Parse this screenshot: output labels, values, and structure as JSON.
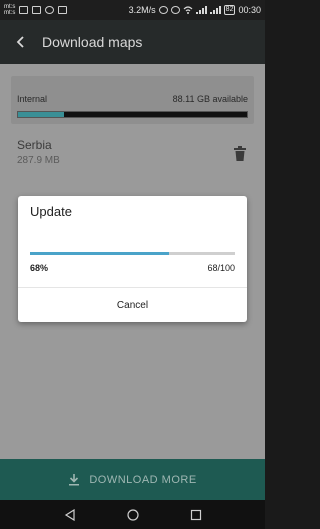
{
  "status_bar": {
    "carrier_line1": "mt:s",
    "carrier_line2": "mt:s",
    "speed": "3.2M/s",
    "battery": "82",
    "time": "00:30"
  },
  "appbar": {
    "title": "Download maps"
  },
  "storage": {
    "label": "Internal",
    "available": "88.11 GB available",
    "used_fraction": 0.2
  },
  "map_item": {
    "name": "Serbia",
    "size": "287.9 MB"
  },
  "dialog": {
    "title": "Update",
    "progress_percent": "68%",
    "progress_count": "68/100",
    "progress_value": 0.68,
    "cancel_label": "Cancel"
  },
  "download_bar": {
    "label": "DOWNLOAD MORE"
  },
  "colors": {
    "accent": "#4aa3c9",
    "download_bar": "#1e5a52",
    "storage_fill": "#3a8f96"
  }
}
